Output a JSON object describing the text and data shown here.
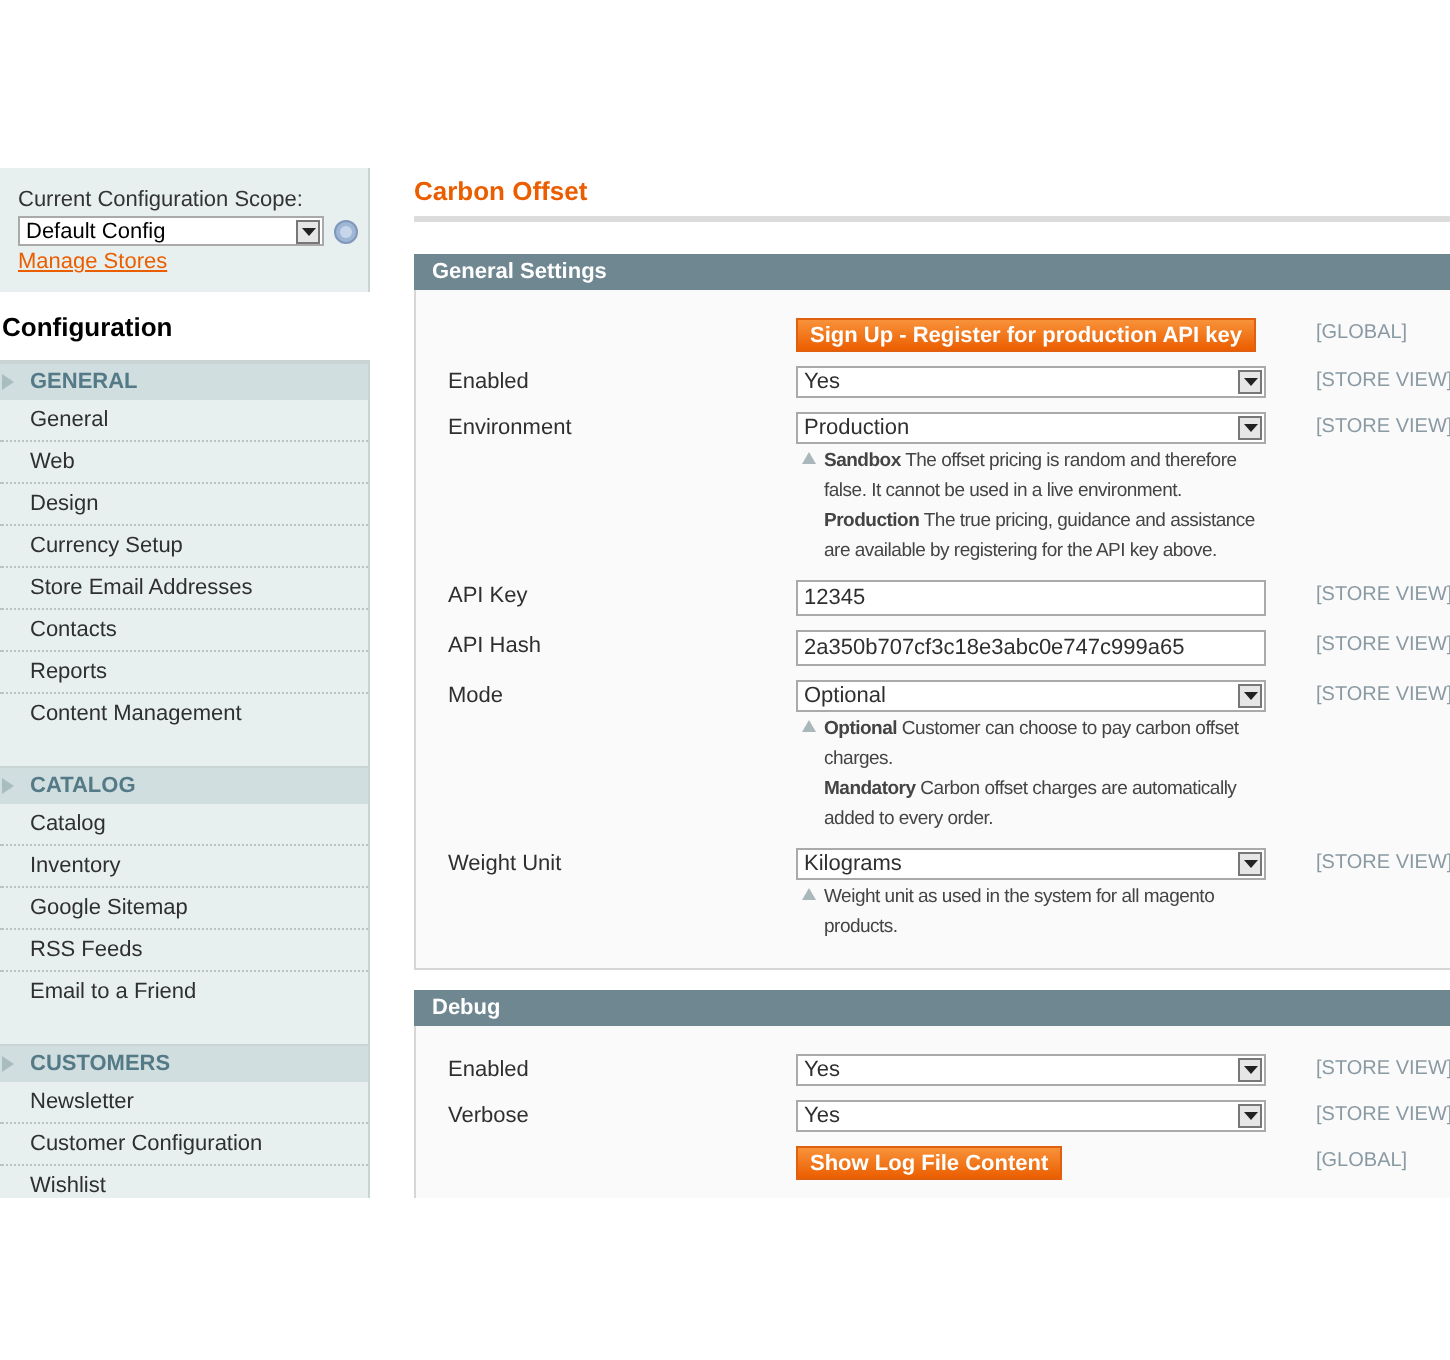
{
  "scope": {
    "label": "Current Configuration Scope:",
    "value": "Default Config",
    "manage_link": "Manage Stores"
  },
  "sidebar": {
    "title": "Configuration",
    "groups": [
      {
        "label": "GENERAL",
        "items": [
          "General",
          "Web",
          "Design",
          "Currency Setup",
          "Store Email Addresses",
          "Contacts",
          "Reports",
          "Content Management"
        ]
      },
      {
        "label": "CATALOG",
        "items": [
          "Catalog",
          "Inventory",
          "Google Sitemap",
          "RSS Feeds",
          "Email to a Friend"
        ]
      },
      {
        "label": "CUSTOMERS",
        "items": [
          "Newsletter",
          "Customer Configuration",
          "Wishlist"
        ]
      }
    ]
  },
  "page_title": "Carbon Offset",
  "sections": [
    {
      "title": "General Settings",
      "rows": [
        {
          "kind": "button",
          "value": "Sign Up - Register for production API key",
          "scope": "[GLOBAL]"
        },
        {
          "kind": "select",
          "label": "Enabled",
          "value": "Yes",
          "scope": "[STORE VIEW]"
        },
        {
          "kind": "select",
          "label": "Environment",
          "value": "Production",
          "scope": "[STORE VIEW]",
          "notes": [
            "**Sandbox** The offset pricing is random and therefore false. It cannot be used in a live environment.",
            "**Production** The true pricing, guidance and assistance are available by registering for the API key above."
          ]
        },
        {
          "kind": "text",
          "label": "API Key",
          "value": "12345",
          "scope": "[STORE VIEW]"
        },
        {
          "kind": "text",
          "label": "API Hash",
          "value": "2a350b707cf3c18e3abc0e747c999a65",
          "scope": "[STORE VIEW]"
        },
        {
          "kind": "select",
          "label": "Mode",
          "value": "Optional",
          "scope": "[STORE VIEW]",
          "notes": [
            "**Optional** Customer can choose to pay carbon offset charges.",
            "**Mandatory** Carbon offset charges are automatically added to every order."
          ]
        },
        {
          "kind": "select",
          "label": "Weight Unit",
          "value": "Kilograms",
          "scope": "[STORE VIEW]",
          "notes": [
            "Weight unit as used in the system for all magento products."
          ]
        }
      ]
    },
    {
      "title": "Debug",
      "rows": [
        {
          "kind": "select",
          "label": "Enabled",
          "value": "Yes",
          "scope": "[STORE VIEW]"
        },
        {
          "kind": "select",
          "label": "Verbose",
          "value": "Yes",
          "scope": "[STORE VIEW]"
        },
        {
          "kind": "button",
          "value": "Show Log File Content",
          "scope": "[GLOBAL]"
        }
      ]
    }
  ]
}
